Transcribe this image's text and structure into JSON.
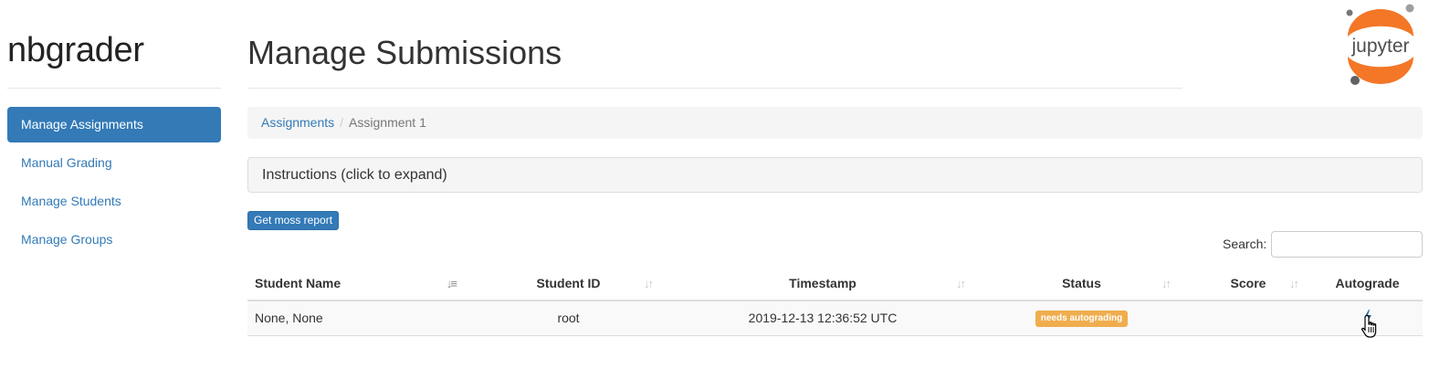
{
  "sidebar": {
    "brand": "nbgrader",
    "items": [
      {
        "label": "Manage Assignments",
        "active": true
      },
      {
        "label": "Manual Grading",
        "active": false
      },
      {
        "label": "Manage Students",
        "active": false
      },
      {
        "label": "Manage Groups",
        "active": false
      }
    ]
  },
  "header": {
    "title": "Manage Submissions",
    "logo_text": "jupyter"
  },
  "breadcrumb": {
    "root": "Assignments",
    "separator": "/",
    "current": "Assignment 1"
  },
  "instructions": {
    "label": "Instructions (click to expand)"
  },
  "actions": {
    "moss_label": "Get moss report"
  },
  "search": {
    "label": "Search:",
    "value": ""
  },
  "table": {
    "headers": {
      "student_name": "Student Name",
      "student_id": "Student ID",
      "timestamp": "Timestamp",
      "status": "Status",
      "score": "Score",
      "autograde": "Autograde"
    },
    "rows": [
      {
        "student_name": "None, None",
        "student_id": "root",
        "timestamp": "2019-12-13 12:36:52 UTC",
        "status": "needs autograding",
        "score": ""
      }
    ]
  },
  "colors": {
    "primary": "#337ab7",
    "warning": "#f0ad4e",
    "jupyter_orange": "#f37726"
  },
  "icons": {
    "sort": "sort-icon",
    "sort_active": "sort-alpha-asc-icon",
    "autograde": "flash-icon",
    "cursor": "hand-pointer-icon"
  }
}
